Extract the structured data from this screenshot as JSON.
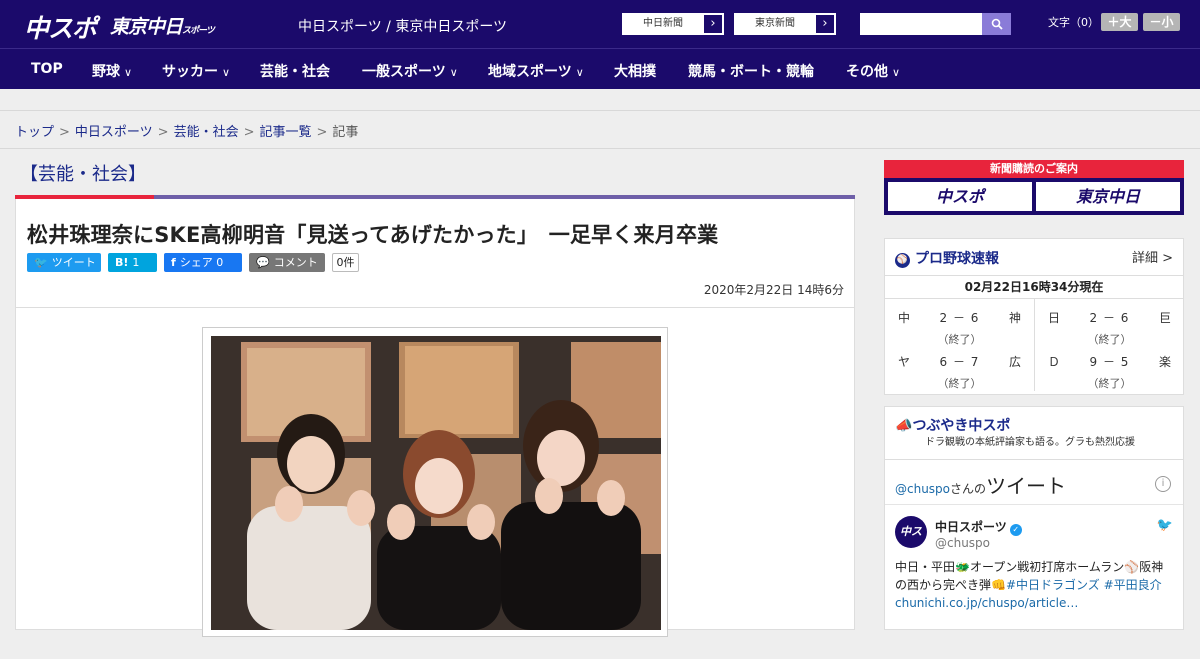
{
  "header": {
    "logo_main": "中スポ",
    "logo_sub": "東京中日",
    "logo_sub_small": "スポーツ",
    "site_names": "中日スポーツ / 東京中日スポーツ",
    "link_chunichi": "中日新聞",
    "link_tokyo": "東京新聞",
    "font_size_label": "文字（0）",
    "font_bigger": "＋大",
    "font_smaller": "－小"
  },
  "nav": {
    "items": [
      {
        "label": "TOP",
        "dropdown": false
      },
      {
        "label": "野球",
        "dropdown": true
      },
      {
        "label": "サッカー",
        "dropdown": true
      },
      {
        "label": "芸能・社会",
        "dropdown": false
      },
      {
        "label": "一般スポーツ",
        "dropdown": true
      },
      {
        "label": "地域スポーツ",
        "dropdown": true
      },
      {
        "label": "大相撲",
        "dropdown": false
      },
      {
        "label": "競馬・ボート・競輪",
        "dropdown": false
      },
      {
        "label": "その他",
        "dropdown": true
      }
    ]
  },
  "breadcrumb": {
    "items": [
      "トップ",
      "中日スポーツ",
      "芸能・社会",
      "記事一覧"
    ],
    "current": "記事",
    "separator": ">"
  },
  "article": {
    "section": "【芸能・社会】",
    "headline": "松井珠理奈にSKE高柳明音「見送ってあげたかった」　一足早く来月卒業",
    "share": {
      "tweet": "ツイート",
      "hatena_count": "1",
      "facebook": "シェア",
      "facebook_count": "0",
      "comment": "コメント",
      "comment_count": "0件"
    },
    "date": "2020年2月22日 14時6分"
  },
  "sidebar": {
    "subscribe_title": "新聞購読のご案内",
    "subscribe_left": "中スポ",
    "subscribe_right": "東京中日",
    "baseball": {
      "title": "プロ野球速報",
      "more": "詳細 >",
      "as_of": "02月22日16時34分現在",
      "games": [
        {
          "home": "中",
          "score": "2 － 6",
          "away": "神",
          "status": "（終了）"
        },
        {
          "home": "日",
          "score": "2 － 6",
          "away": "巨",
          "status": "（終了）"
        },
        {
          "home": "ヤ",
          "score": "6 － 7",
          "away": "広",
          "status": "（終了）"
        },
        {
          "home": "Ｄ",
          "score": "9 － 5",
          "away": "楽",
          "status": "（終了）"
        }
      ]
    },
    "tsubuyaki": {
      "title": "つぶやき中スポ",
      "subtitle": "ドラ観戦の本紙評論家も語る。グラも熱烈応援",
      "embed_handle_prefix": "@chuspo",
      "embed_handle_suffix": "さんの",
      "embed_title": "ツイート",
      "tweet_name": "中日スポーツ",
      "tweet_handle": "@chuspo",
      "tweet_text_1": "中日・平田🐲オープン戦初打席ホームラン⚾阪神の西から完ぺき弾👊",
      "tweet_hash_1": "#中日ドラゴンズ",
      "tweet_hash_2": "#平田良介",
      "tweet_link": "chunichi.co.jp/chuspo/article…"
    }
  },
  "colors": {
    "brand_navy": "#1b0a6b",
    "accent_red": "#e8243c",
    "link_blue": "#1b2a8a",
    "twitter_blue": "#1d9bf0",
    "hatena_blue": "#00a4de",
    "facebook_blue": "#1877f2",
    "comment_gray": "#777777"
  },
  "icons": [
    "search-icon",
    "twitter-bird-icon",
    "facebook-icon",
    "hatena-icon",
    "comment-icon",
    "baseball-icon",
    "megaphone-icon",
    "verified-icon",
    "info-icon",
    "chevron-right-icon",
    "chevron-down-icon"
  ]
}
